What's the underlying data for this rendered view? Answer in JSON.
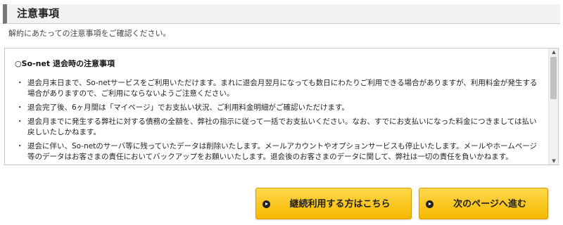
{
  "section": {
    "title": "注意事項"
  },
  "intro": "解約にあたっての注意事項をご確認ください。",
  "notice": {
    "heading": "○So-net 退会時の注意事項",
    "bullet": "・",
    "items": [
      "退会月末日まで、So-netサービスをご利用いただけます。まれに退会月翌月になっても数日にわたりご利用できる場合がありますが、利用料金が発生する場合がありますので、ご利用にならないようご注意ください。",
      "退会完了後、6ヶ月間は「マイページ」でお支払い状況、ご利用料金明細がご確認いただけます。",
      "退会月までに発生する弊社に対する債務の全額を、弊社の指示に従って一括でお支払いください。なお、すでにお支払いになった料金につきましては払い戻しいたしかねます。",
      "退会に伴い、So-netのサーバ等に残っていたデータは削除いたします。メールアカウントやオプションサービスも停止いたします。メールやホームページ等のデータはお客さまの責任においてバックアップをお願いいたします。退会後のお客さまのデータに関して、弊社は一切の責任を負いかねます。"
    ]
  },
  "scrollbar": {
    "up_arrow": "▲",
    "down_arrow": "▼"
  },
  "buttons": {
    "continue_label": "継続利用する方はこちら",
    "next_label": "次のページへ進む"
  },
  "colors": {
    "button_gradient_top": "#ffd84a",
    "button_gradient_bottom": "#f5b800",
    "header_accent": "#777777"
  },
  "icons": {
    "button_icon": "circle-arrow-right-icon"
  }
}
